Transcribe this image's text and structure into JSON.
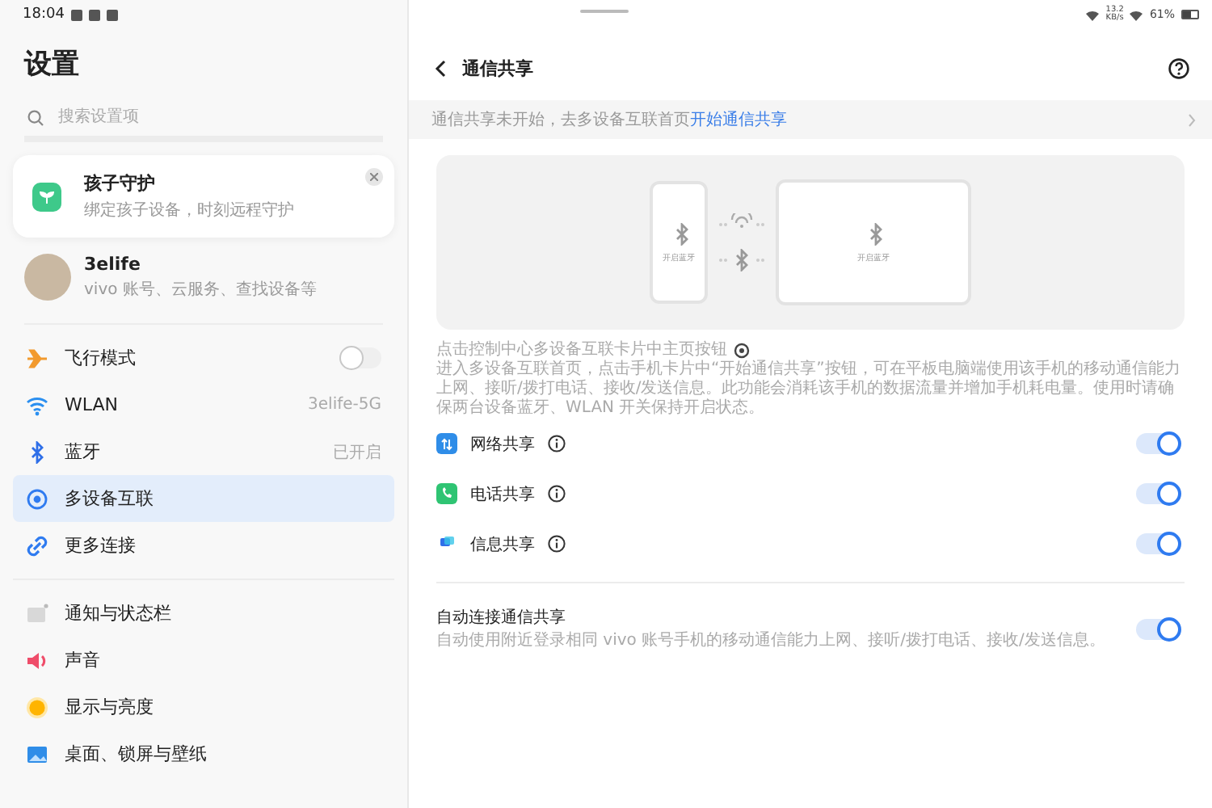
{
  "status_bar": {
    "time": "18:04",
    "net_speed": "13.2",
    "net_unit": "KB/s",
    "battery": "61%"
  },
  "sidebar": {
    "title": "设置",
    "search": {
      "placeholder": "搜索设置项"
    },
    "promo": {
      "title": "孩子守护",
      "subtitle": "绑定孩子设备，时刻远程守护"
    },
    "account": {
      "name": "3elife",
      "subtitle": "vivo 账号、云服务、查找设备等"
    },
    "groups": [
      [
        {
          "kind": "toggle",
          "label": "飞行模式",
          "on": false,
          "selected": false
        },
        {
          "kind": "value",
          "label": "WLAN",
          "value": "3elife-5G",
          "selected": false
        },
        {
          "kind": "value",
          "label": "蓝牙",
          "value": "已开启",
          "selected": false
        },
        {
          "kind": "link",
          "label": "多设备互联",
          "selected": true
        },
        {
          "kind": "link",
          "label": "更多连接",
          "selected": false
        }
      ],
      [
        {
          "kind": "link",
          "label": "通知与状态栏",
          "selected": false
        },
        {
          "kind": "link",
          "label": "声音",
          "selected": false
        },
        {
          "kind": "link",
          "label": "显示与亮度",
          "selected": false
        },
        {
          "kind": "link",
          "label": "桌面、锁屏与壁纸",
          "selected": false
        }
      ]
    ]
  },
  "page": {
    "title": "通信共享",
    "banner": {
      "text": "通信共享未开始，去多设备互联首页",
      "link": "开始通信共享"
    },
    "illustration": {
      "phone_label": "开启蓝牙",
      "tablet_label": "开启蓝牙"
    },
    "description_before": "点击控制中心多设备互联卡片中主页按钮",
    "description_after": "进入多设备互联首页，点击手机卡片中“开始通信共享”按钮，可在平板电脑端使用该手机的移动通信能力上网、接听/拨打电话、接收/发送信息。此功能会消耗该手机的数据流量并增加手机耗电量。使用时请确保两台设备蓝牙、WLAN 开关保持开启状态。",
    "features": [
      {
        "label": "网络共享",
        "on": true
      },
      {
        "label": "电话共享",
        "on": true
      },
      {
        "label": "信息共享",
        "on": true
      }
    ],
    "auto": {
      "title": "自动连接通信共享",
      "subtitle": "自动使用附近登录相同 vivo 账号手机的移动通信能力上网、接听/拨打电话、接收/发送信息。",
      "on": true
    }
  }
}
